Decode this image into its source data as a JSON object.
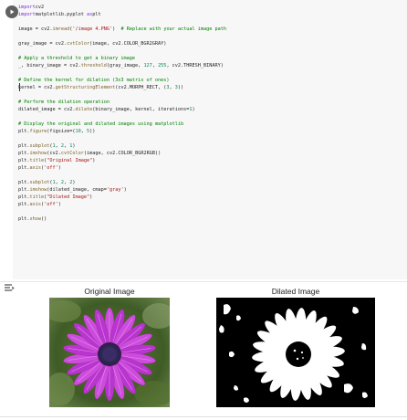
{
  "notebook": {
    "run_button_icon": "play-icon",
    "output_toggle_icon": "output-toggle-icon"
  },
  "code_lines": [
    [
      [
        "kw",
        "import"
      ],
      [
        "",
        "cv2"
      ]
    ],
    [
      [
        "kw",
        "import"
      ],
      [
        "",
        "matplotlib.pyplot "
      ],
      [
        "kw",
        "as"
      ],
      [
        "",
        "plt"
      ]
    ],
    [],
    [
      [
        "",
        "image = cv2."
      ],
      [
        "fn",
        "imread"
      ],
      [
        "",
        "("
      ],
      [
        "str",
        "'/image 4.PNG'"
      ],
      [
        "",
        ")  "
      ],
      [
        "cm",
        "# Replace with your actual image path"
      ]
    ],
    [],
    [
      [
        "",
        "gray_image = cv2."
      ],
      [
        "fn",
        "cvtColor"
      ],
      [
        "",
        "(image, cv2.COLOR_BGR2GRAY)"
      ]
    ],
    [],
    [
      [
        "cm",
        "# Apply a threshold to get a binary image"
      ]
    ],
    [
      [
        "",
        "_, binary_image = cv2."
      ],
      [
        "fn",
        "threshold"
      ],
      [
        "",
        "(gray_image, "
      ],
      [
        "num",
        "127"
      ],
      [
        "",
        ", "
      ],
      [
        "num",
        "255"
      ],
      [
        "",
        ", cv2.THRESH_BINARY)"
      ]
    ],
    [],
    [
      [
        "cm",
        "# Define the kernel for dilation (3x3 matrix of ones)"
      ]
    ],
    [
      [
        "",
        "kernel = cv2."
      ],
      [
        "fn",
        "getStructuringElement"
      ],
      [
        "",
        "(cv2.MORPH_RECT, ("
      ],
      [
        "num",
        "3"
      ],
      [
        "",
        ", "
      ],
      [
        "num",
        "3"
      ],
      [
        "",
        "))"
      ]
    ],
    [],
    [
      [
        "cm",
        "# Perform the dilation operation"
      ]
    ],
    [
      [
        "",
        "dilated_image = cv2."
      ],
      [
        "fn",
        "dilate"
      ],
      [
        "",
        "(binary_image, kernel, iterations="
      ],
      [
        "num",
        "1"
      ],
      [
        "",
        ")"
      ]
    ],
    [],
    [
      [
        "cm",
        "# Display the original and dilated images using matplotlib"
      ]
    ],
    [
      [
        "",
        "plt."
      ],
      [
        "fn",
        "figure"
      ],
      [
        "",
        "(figsize=("
      ],
      [
        "num",
        "10"
      ],
      [
        "",
        ", "
      ],
      [
        "num",
        "5"
      ],
      [
        "",
        "))"
      ]
    ],
    [],
    [
      [
        "",
        "plt."
      ],
      [
        "fn",
        "subplot"
      ],
      [
        "",
        "("
      ],
      [
        "num",
        "1"
      ],
      [
        "",
        ", "
      ],
      [
        "num",
        "2"
      ],
      [
        "",
        ", "
      ],
      [
        "num",
        "1"
      ],
      [
        "",
        ")"
      ]
    ],
    [
      [
        "",
        "plt."
      ],
      [
        "fn",
        "imshow"
      ],
      [
        "",
        "(cv2."
      ],
      [
        "fn",
        "cvtColor"
      ],
      [
        "",
        "(image, cv2.COLOR_BGR2RGB))"
      ]
    ],
    [
      [
        "",
        "plt."
      ],
      [
        "fn",
        "title"
      ],
      [
        "",
        "("
      ],
      [
        "str",
        "\"Original Image\""
      ],
      [
        "",
        ")"
      ]
    ],
    [
      [
        "",
        "plt."
      ],
      [
        "fn",
        "axis"
      ],
      [
        "",
        "("
      ],
      [
        "str",
        "'off'"
      ],
      [
        "",
        ")"
      ]
    ],
    [],
    [
      [
        "",
        "plt."
      ],
      [
        "fn",
        "subplot"
      ],
      [
        "",
        "("
      ],
      [
        "num",
        "1"
      ],
      [
        "",
        ", "
      ],
      [
        "num",
        "2"
      ],
      [
        "",
        ", "
      ],
      [
        "num",
        "2"
      ],
      [
        "",
        ")"
      ]
    ],
    [
      [
        "",
        "plt."
      ],
      [
        "fn",
        "imshow"
      ],
      [
        "",
        "(dilated_image, cmap="
      ],
      [
        "str",
        "'gray'"
      ],
      [
        "",
        ")"
      ]
    ],
    [
      [
        "",
        "plt."
      ],
      [
        "fn",
        "title"
      ],
      [
        "",
        "("
      ],
      [
        "str",
        "\"Dilated Image\""
      ],
      [
        "",
        ")"
      ]
    ],
    [
      [
        "",
        "plt."
      ],
      [
        "fn",
        "axis"
      ],
      [
        "",
        "("
      ],
      [
        "str",
        "'off'"
      ],
      [
        "",
        ")"
      ]
    ],
    [],
    [
      [
        "",
        "plt."
      ],
      [
        "fn",
        "show"
      ],
      [
        "",
        "()"
      ]
    ]
  ],
  "output": {
    "original_title": "Original Image",
    "dilated_title": "Dilated Image"
  },
  "colors": {
    "cell_background": "#f7f7f7",
    "keyword": "#7b30d0",
    "string": "#a31515",
    "comment": "#008000",
    "number": "#098658",
    "flower_petal": "#c23fd6",
    "flower_center": "#3b2a6a",
    "foliage": "#4a6b2e"
  }
}
